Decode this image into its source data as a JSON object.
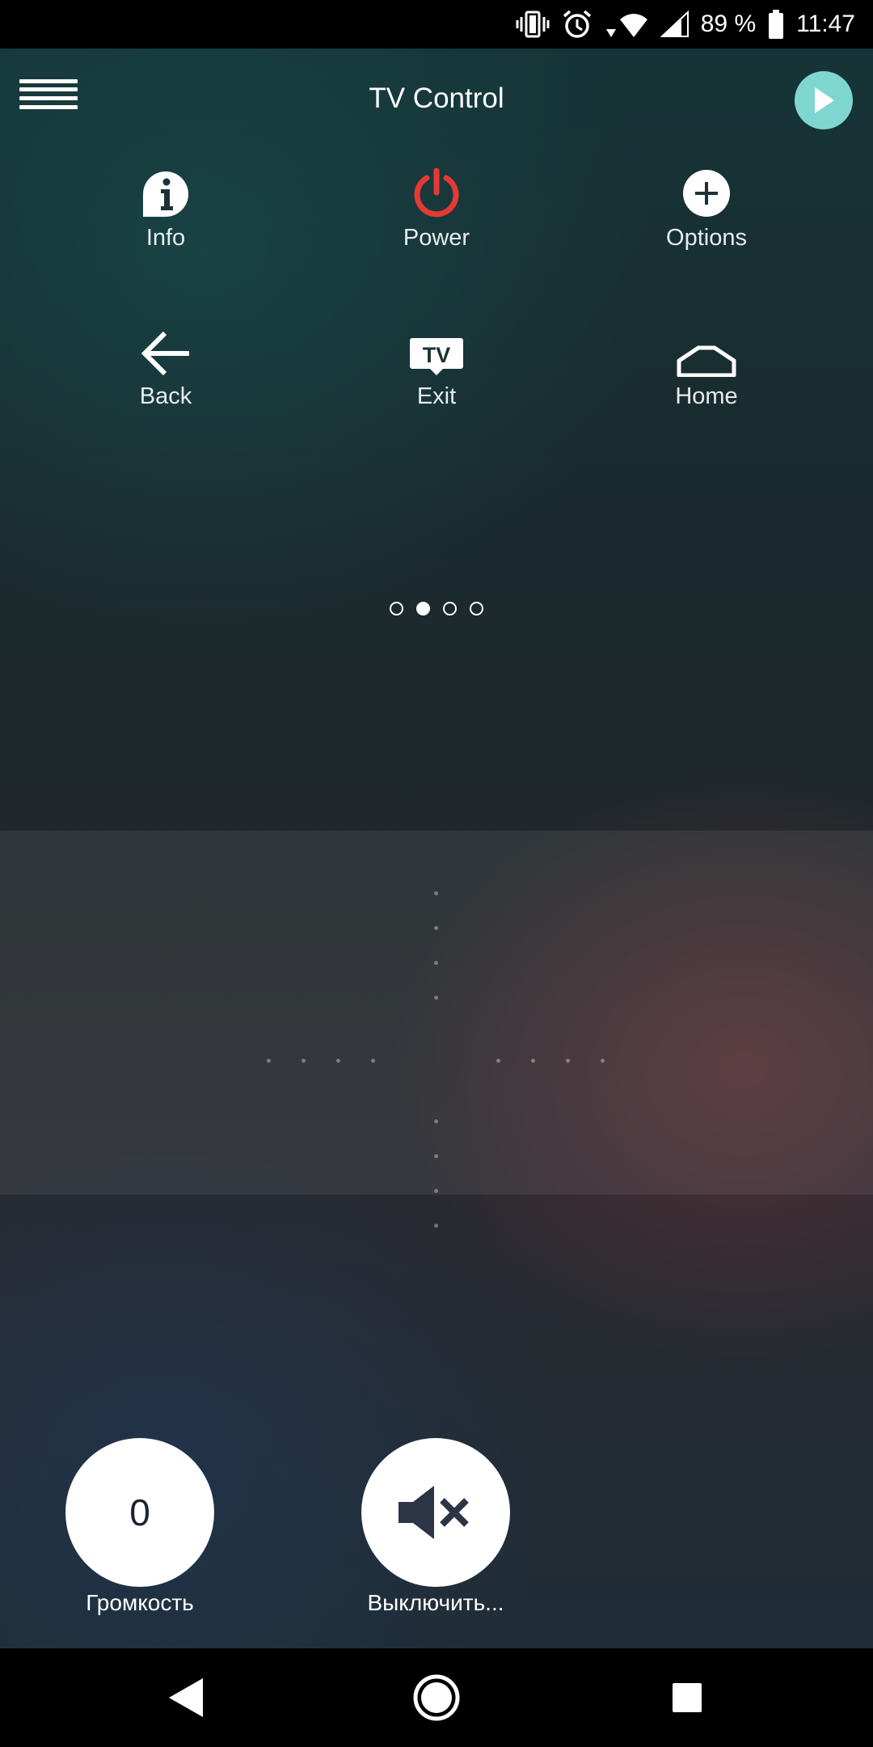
{
  "status_bar": {
    "battery_percent": "89 %",
    "time": "11:47",
    "icons": [
      "vibrate-icon",
      "alarm-icon",
      "wifi-icon",
      "signal-icon",
      "battery-icon"
    ]
  },
  "header": {
    "title": "TV Control",
    "menu_icon": "hamburger-menu-icon",
    "play_icon": "play-icon",
    "play_color": "#7fd6d0"
  },
  "remote_buttons": [
    {
      "label": "Info",
      "icon": "info-icon"
    },
    {
      "label": "Power",
      "icon": "power-icon",
      "color": "#e53935"
    },
    {
      "label": "Options",
      "icon": "plus-circle-icon"
    },
    {
      "label": "Back",
      "icon": "arrow-left-icon"
    },
    {
      "label": "Exit",
      "icon": "tv-icon",
      "icon_text": "TV"
    },
    {
      "label": "Home",
      "icon": "home-icon"
    }
  ],
  "pager": {
    "pages": 4,
    "active_index": 1
  },
  "bottom_controls": {
    "volume": {
      "value": "0",
      "label": "Громкость"
    },
    "mute": {
      "label": "Выключить...",
      "icon": "mute-icon"
    }
  },
  "nav_bar": {
    "icons": [
      "nav-back-icon",
      "nav-home-icon",
      "nav-recents-icon"
    ]
  }
}
